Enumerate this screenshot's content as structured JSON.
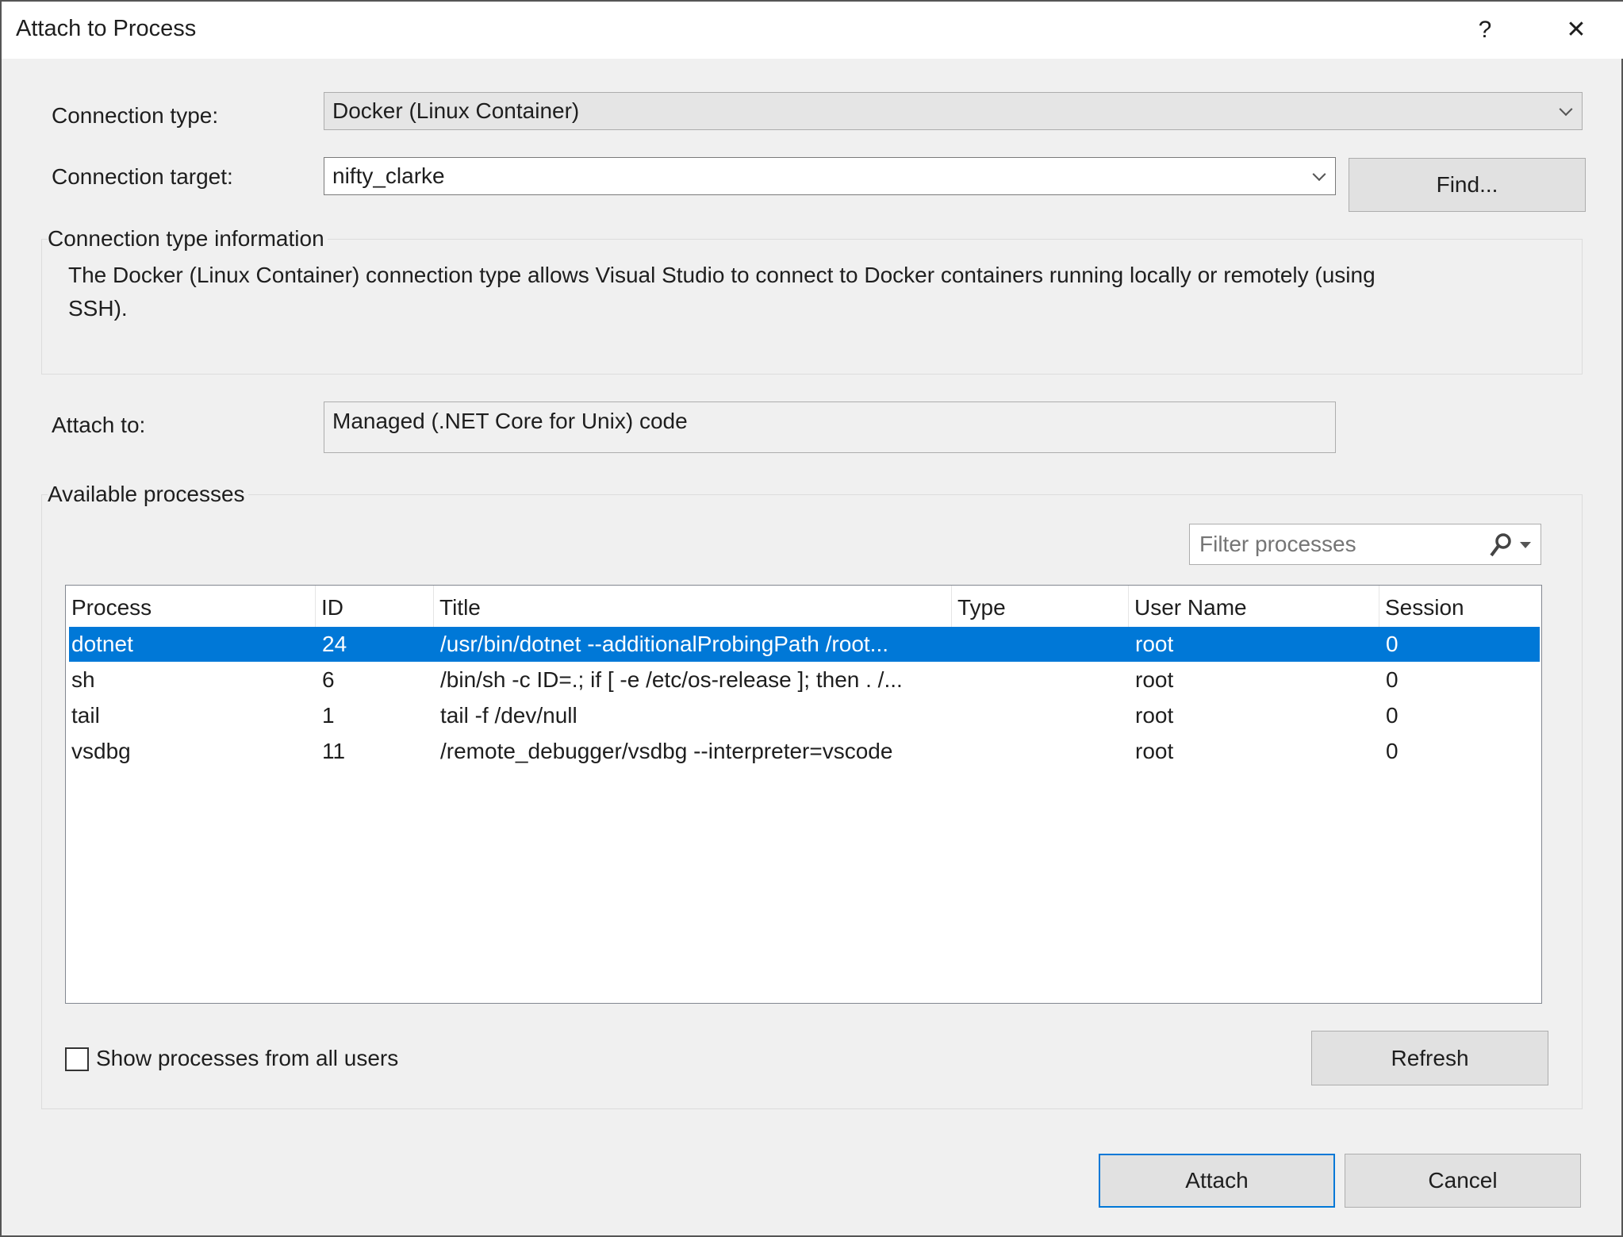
{
  "window": {
    "title": "Attach to Process",
    "help": "?",
    "close": "✕"
  },
  "connection_type": {
    "label": "Connection type:",
    "value": "Docker (Linux Container)"
  },
  "connection_target": {
    "label": "Connection target:",
    "value": "nifty_clarke",
    "find": "Find..."
  },
  "info": {
    "label": "Connection type information",
    "line1": "The Docker (Linux Container) connection type allows Visual Studio to connect to Docker containers running locally or remotely (using",
    "line2": "SSH)."
  },
  "attach_to": {
    "label": "Attach to:",
    "value": "Managed (.NET Core for Unix) code"
  },
  "processes": {
    "label": "Available processes",
    "filter_placeholder": "Filter processes",
    "columns": [
      "Process",
      "ID",
      "Title",
      "Type",
      "User Name",
      "Session"
    ],
    "rows": [
      [
        "dotnet",
        "24",
        "/usr/bin/dotnet --additionalProbingPath /root...",
        "",
        "root",
        "0"
      ],
      [
        "sh",
        "6",
        "/bin/sh -c ID=.; if [ -e /etc/os-release ]; then . /...",
        "",
        "root",
        "0"
      ],
      [
        "tail",
        "1",
        "tail -f /dev/null",
        "",
        "root",
        "0"
      ],
      [
        "vsdbg",
        "11",
        "/remote_debugger/vsdbg --interpreter=vscode",
        "",
        "root",
        "0"
      ]
    ],
    "selected_index": 0,
    "show_all_users": "Show processes from all users",
    "show_all_checked": false,
    "refresh": "Refresh"
  },
  "buttons": {
    "attach": "Attach",
    "cancel": "Cancel"
  },
  "colors": {
    "selection": "#0078d7"
  }
}
